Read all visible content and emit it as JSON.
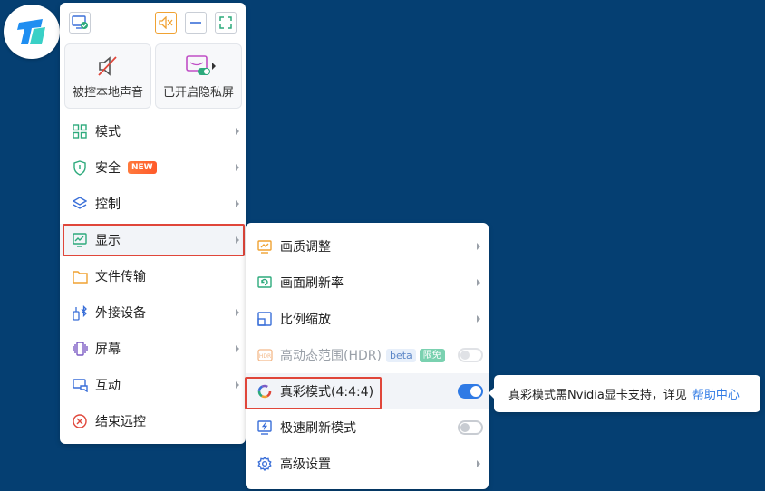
{
  "logo": {
    "icon": "todesk-logo-icon"
  },
  "topbar": {
    "buttons": [
      {
        "name": "screen-status-icon"
      },
      {
        "name": "mute-icon"
      },
      {
        "name": "minimize-icon"
      },
      {
        "name": "fullscreen-icon"
      }
    ]
  },
  "quick": {
    "mute_label": "被控本地声音",
    "privacy_label": "已开启隐私屏"
  },
  "menu": {
    "items": [
      {
        "label": "模式",
        "icon": "grid-icon",
        "has_arrow": true
      },
      {
        "label": "安全",
        "icon": "shield-icon",
        "badge": "NEW",
        "has_arrow": true
      },
      {
        "label": "控制",
        "icon": "layers-icon",
        "has_arrow": true
      },
      {
        "label": "显示",
        "icon": "monitor-chart-icon",
        "has_arrow": true
      },
      {
        "label": "文件传输",
        "icon": "folder-icon",
        "has_arrow": false
      },
      {
        "label": "外接设备",
        "icon": "usb-bluetooth-icon",
        "has_arrow": true
      },
      {
        "label": "屏幕",
        "icon": "screens-icon",
        "has_arrow": true
      },
      {
        "label": "互动",
        "icon": "chat-screen-icon",
        "has_arrow": true
      },
      {
        "label": "结束远控",
        "icon": "close-circle-icon",
        "has_arrow": false
      }
    ]
  },
  "submenu": {
    "items": [
      {
        "label": "画质调整",
        "icon": "quality-icon",
        "has_arrow": true
      },
      {
        "label": "画面刷新率",
        "icon": "refresh-rate-icon",
        "has_arrow": true
      },
      {
        "label": "比例缩放",
        "icon": "scale-icon",
        "has_arrow": true
      },
      {
        "label": "高动态范围(HDR)",
        "icon": "hdr-icon",
        "beta": "beta",
        "free": "限免",
        "toggle": false
      },
      {
        "label": "真彩模式(4:4:4)",
        "icon": "color-wheel-icon",
        "toggle": true
      },
      {
        "label": "极速刷新模式",
        "icon": "fast-refresh-icon",
        "toggle": false
      },
      {
        "label": "高级设置",
        "icon": "gear-icon",
        "has_arrow": true
      }
    ]
  },
  "tooltip": {
    "text": "真彩模式需Nvidia显卡支持，详见",
    "link": "帮助中心"
  },
  "colors": {
    "background": "#053f72",
    "accent": "#2f7ae5",
    "highlight_border": "#e0463a",
    "icon_green": "#2daa7c",
    "icon_blue": "#3a6fd8",
    "icon_orange": "#f0a232",
    "icon_purple": "#7c5cc4",
    "icon_red": "#e0463a"
  }
}
